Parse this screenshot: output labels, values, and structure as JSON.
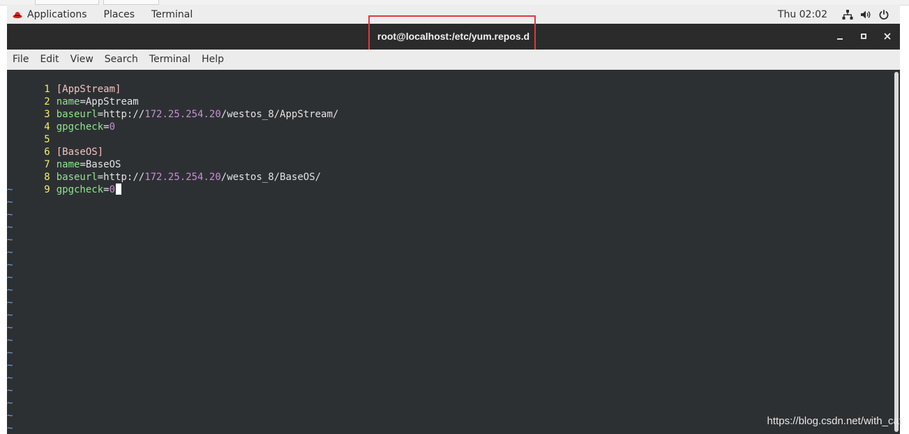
{
  "topbar": {
    "applications": "Applications",
    "places": "Places",
    "terminal": "Terminal",
    "clock": "Thu 02:02"
  },
  "window": {
    "title": "root@localhost:/etc/yum.repos.d"
  },
  "menu": {
    "file": "File",
    "edit": "Edit",
    "view": "View",
    "search": "Search",
    "terminal": "Terminal",
    "help": "Help"
  },
  "editor": {
    "line_numbers": [
      "1",
      "2",
      "3",
      "4",
      "5",
      "6",
      "7",
      "8",
      "9"
    ],
    "l1": "[AppStream]",
    "l2_key": "name",
    "l2_val": "AppStream",
    "l3_key": "baseurl",
    "l3_proto": "http://",
    "l3_ip": "172.25.254.20",
    "l3_path": "/westos_8/AppStream/",
    "l4_key": "gpgcheck",
    "l4_val": "0",
    "l6": "[BaseOS]",
    "l7_key": "name",
    "l7_val": "BaseOS",
    "l8_key": "baseurl",
    "l8_proto": "http://",
    "l8_ip": "172.25.254.20",
    "l8_path": "/westos_8/BaseOS/",
    "l9_key": "gpgcheck",
    "l9_val": "0",
    "equals": "=",
    "tilde": "~"
  },
  "watermark": "https://blog.csdn.net/with_cat",
  "colors": {
    "highlight_box": "#e0383e",
    "terminal_bg": "#2d3033",
    "line_number": "#f2f06a",
    "section": "#f4c0c0",
    "key": "#8ee58e",
    "number": "#c78fd4",
    "tilde": "#6fa0e0"
  },
  "icons": [
    "redhat-icon",
    "network-icon",
    "volume-icon",
    "power-icon",
    "minimize-icon",
    "maximize-icon",
    "close-icon"
  ]
}
